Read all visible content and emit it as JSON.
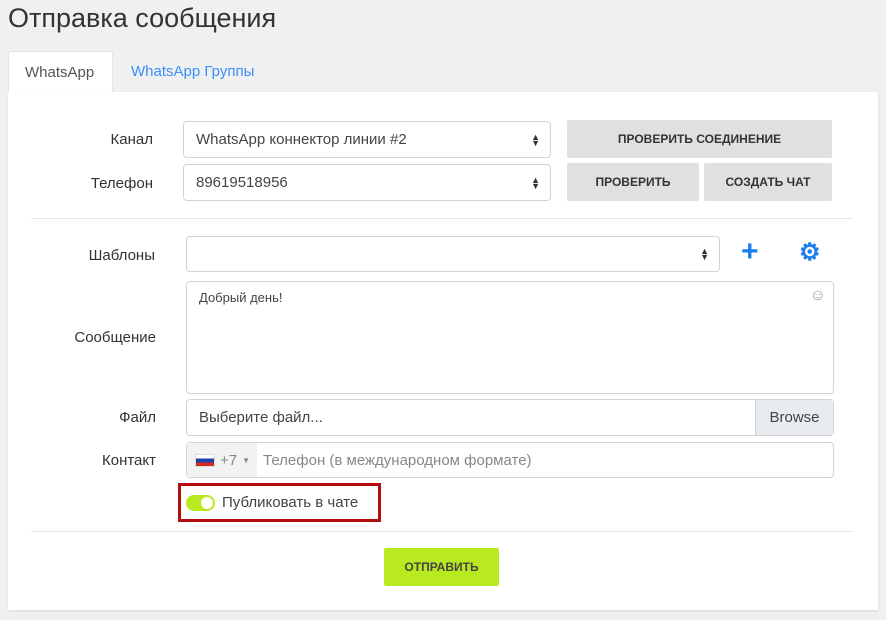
{
  "title": "Отправка сообщения",
  "tabs": [
    "WhatsApp",
    "WhatsApp Группы"
  ],
  "form": {
    "channel_label": "Канал",
    "channel_value": "WhatsApp коннектор линии #2",
    "phone_label": "Телефон",
    "phone_value": "89619518956",
    "check_connection": "ПРОВЕРИТЬ СОЕДИНЕНИЕ",
    "check": "ПРОВЕРИТЬ",
    "create_chat": "СОЗДАТЬ ЧАТ",
    "templates_label": "Шаблоны",
    "templates_value": "",
    "message_label": "Сообщение",
    "message_value": "Добрый день!",
    "file_label": "Файл",
    "file_placeholder": "Выберите файл...",
    "browse": "Browse",
    "contact_label": "Контакт",
    "country_code": "+7",
    "contact_placeholder": "Телефон (в международном формате)",
    "publish_label": "Публиковать в чате",
    "publish_on": true,
    "send": "ОТПРАВИТЬ"
  },
  "colors": {
    "accent": "#b9ea1f",
    "link": "#3d8ef7",
    "icon": "#1a7ef0",
    "highlight": "#b50d0d"
  }
}
